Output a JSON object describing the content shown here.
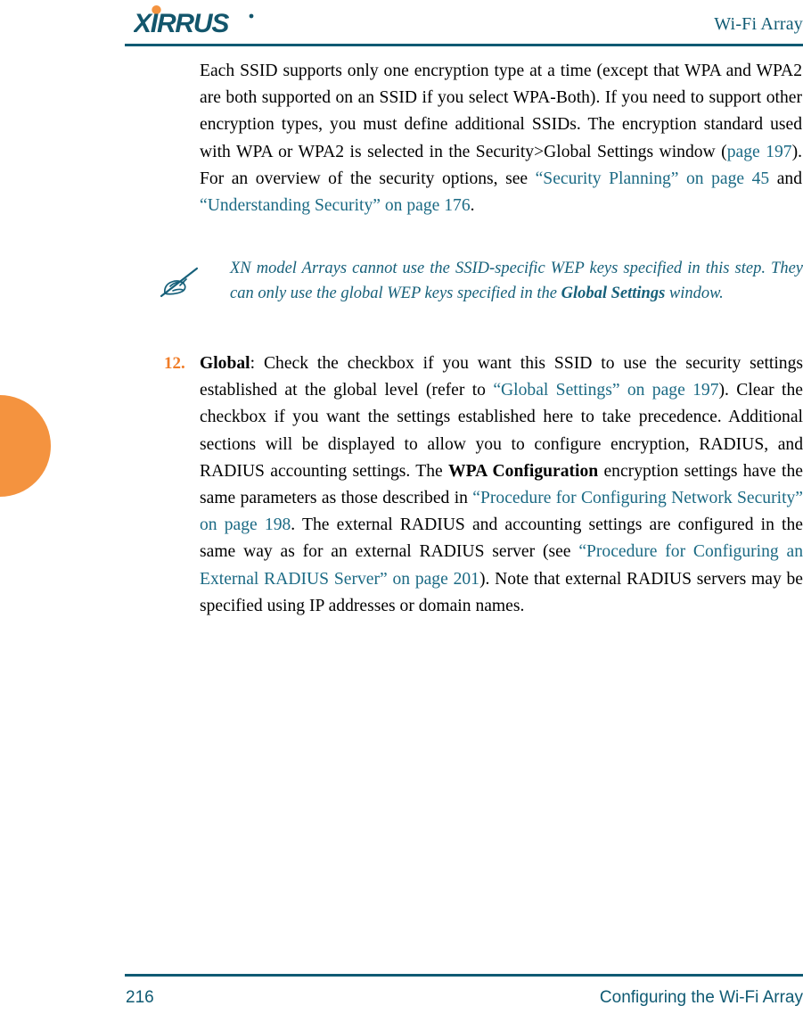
{
  "header": {
    "logo_text": "XIRRUS",
    "logo_trademark": "®",
    "logo_icon_name": "xirrus-logo",
    "title": "Wi-Fi Array"
  },
  "body": {
    "paragraph_1": {
      "segments": [
        {
          "text": "Each SSID supports only one encryption type at a time (except that WPA and WPA2 are both supported on an SSID if you select WPA-Both). If you need to support other encryption types, you must define additional SSIDs. The encryption standard used with WPA or WPA2 is selected in the Security>Global Settings window (",
          "style": "plain"
        },
        {
          "text": "page 197",
          "style": "link"
        },
        {
          "text": "). For an overview of the security options, see ",
          "style": "plain"
        },
        {
          "text": "“Security Planning” on page 45",
          "style": "link"
        },
        {
          "text": " and ",
          "style": "plain"
        },
        {
          "text": "“Understanding Security” on page 176",
          "style": "link"
        },
        {
          "text": ".",
          "style": "plain"
        }
      ]
    }
  },
  "note": {
    "icon_name": "note-pencil-icon",
    "segments": [
      {
        "text": "XN model Arrays cannot use the SSID-specific WEP keys specified in this step. They can only use the global WEP keys specified in the ",
        "style": "italic"
      },
      {
        "text": "Global Settings",
        "style": "bold-italic"
      },
      {
        "text": " window.",
        "style": "italic"
      }
    ]
  },
  "step": {
    "number": "12.",
    "segments": [
      {
        "text": "Global",
        "style": "bold"
      },
      {
        "text": ": Check the checkbox if you want this SSID to use the security settings established at the global level (refer to ",
        "style": "plain"
      },
      {
        "text": "“Global Settings” on page 197",
        "style": "link"
      },
      {
        "text": "). Clear the checkbox if you want the settings established here to take precedence. Additional sections will be displayed to allow you to configure encryption, RADIUS, and RADIUS accounting settings. The ",
        "style": "plain"
      },
      {
        "text": "WPA Configuration",
        "style": "bold"
      },
      {
        "text": " encryption settings have the same parameters as those described in ",
        "style": "plain"
      },
      {
        "text": "“Procedure for Configuring Network Security” on page 198",
        "style": "link"
      },
      {
        "text": ". The external RADIUS and accounting settings are configured in the same way as for an external RADIUS server (see ",
        "style": "plain"
      },
      {
        "text": "“Procedure for Configuring an External RADIUS Server” on page 201",
        "style": "link"
      },
      {
        "text": "). Note that external RADIUS servers may be specified using IP addresses or domain names.",
        "style": "plain"
      }
    ]
  },
  "footer": {
    "page_number": "216",
    "section_title": "Configuring the Wi-Fi Array"
  },
  "colors": {
    "teal": "#0f5a73",
    "link_teal": "#1b6a84",
    "note_teal": "#16607a",
    "orange": "#f4933f",
    "step_orange": "#f07d28",
    "text": "#000000",
    "background": "#ffffff"
  }
}
